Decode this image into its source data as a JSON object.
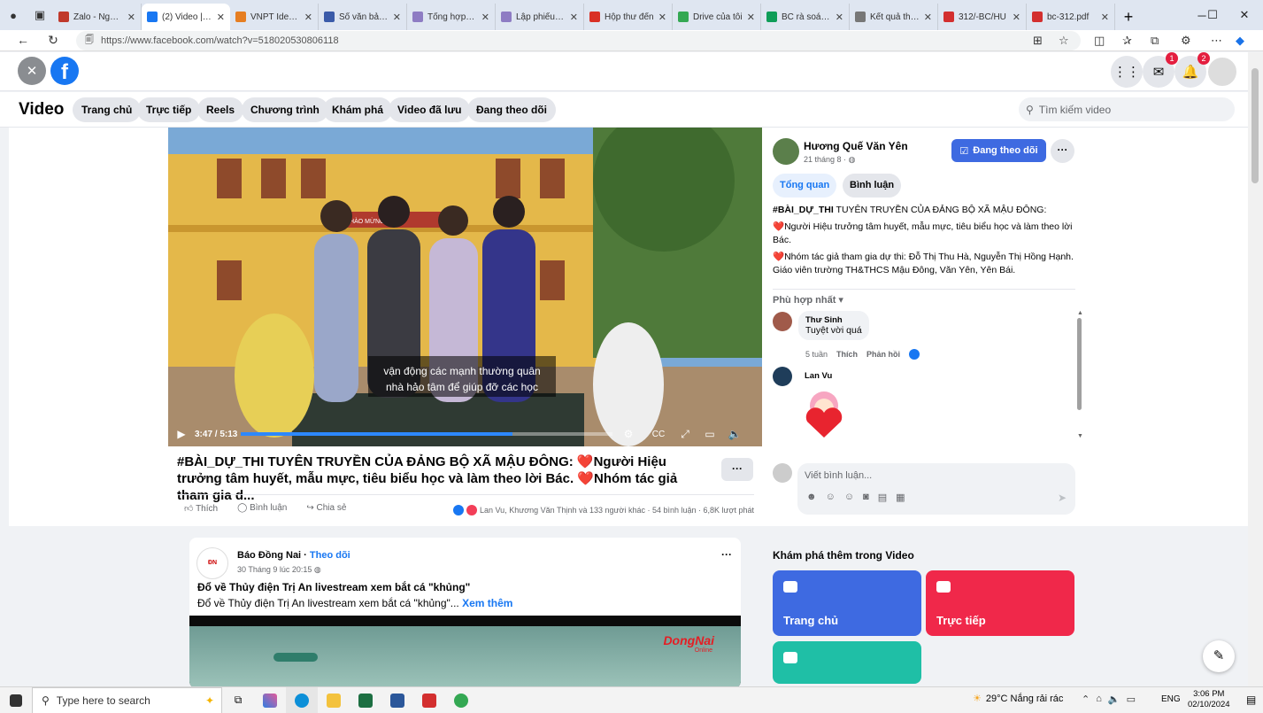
{
  "browser": {
    "tabs": [
      {
        "title": "Zalo - Nguyễ",
        "color": "#c0392b"
      },
      {
        "title": "(2) Video | Fa",
        "color": "#1877f2",
        "active": true
      },
      {
        "title": "VNPT Identity",
        "color": "#e67e22"
      },
      {
        "title": "Sổ văn bản đi",
        "color": "#3b5ba9"
      },
      {
        "title": "Tổng hợp thu",
        "color": "#8e7cc3"
      },
      {
        "title": "Lập phiếu thu",
        "color": "#8e7cc3"
      },
      {
        "title": "Hộp thư đến",
        "color": "#d93025"
      },
      {
        "title": "Drive của tôi",
        "color": "#34a853"
      },
      {
        "title": "BC rà soát vă",
        "color": "#0f9d58"
      },
      {
        "title": "Kết quả thực",
        "color": "#777777"
      },
      {
        "title": "312/-BC/HU",
        "color": "#d32f2f"
      },
      {
        "title": "bc-312.pdf",
        "color": "#d32f2f"
      }
    ],
    "url": "https://www.facebook.com/watch?v=518020530806118",
    "new_tab": "+"
  },
  "fb": {
    "messenger_badge": "1",
    "notif_badge": "2",
    "section_title": "Video",
    "nav": [
      "Trang chủ",
      "Trực tiếp",
      "Reels",
      "Chương trình",
      "Khám phá",
      "Video đã lưu",
      "Đang theo dõi"
    ],
    "search_placeholder": "Tìm kiếm video"
  },
  "video": {
    "subtitle1": "vận động các mạnh thường quân",
    "subtitle2": "nhà hảo tâm để giúp đỡ các học",
    "time": "3:47 / 5:13",
    "progress": 0.73,
    "banner": "CHÀO MỪNG NGÀY",
    "title": "#BÀI_DỰ_THI TUYÊN TRUYỀN CỦA ĐẢNG BỘ XÃ MẬU ĐÔNG: ❤️Người Hiệu trưởng tâm huyết, mẫu mực, tiêu biểu học và làm theo lời Bác. ❤️Nhóm tác giả tham gia d...",
    "more": "···",
    "actions": {
      "like": "Thích",
      "comment": "Bình luận",
      "share": "Chia sẻ"
    },
    "stats": "Lan Vu, Khương Văn Thịnh và 133 người khác · 54 bình luận · 6,8K lượt phát"
  },
  "side": {
    "page_name": "Hương Quế Văn Yên",
    "date": "21 tháng 8 ·",
    "follow": "Đang theo dõi",
    "tabs": [
      "Tổng quan",
      "Bình luận"
    ],
    "desc_hashtag": "#BÀI_DỰ_THI",
    "desc1": " TUYÊN TRUYỀN CỦA ĐẢNG BỘ XÃ MẬU ĐÔNG:",
    "desc2": "❤️Người Hiệu trưởng tâm huyết, mẫu mực, tiêu biểu học và làm theo lời Bác.",
    "desc3": "❤️Nhóm tác giả tham gia dự thi: Đỗ Thị Thu Hà, Nguyễn Thị Hồng Hạnh. Giáo viên trường TH&THCS Mậu Đông, Văn Yên, Yên Bái.",
    "sort": "Phù hợp nhất",
    "comments": [
      {
        "name": "Thư Sinh",
        "text": "Tuyệt vời quá",
        "time": "5 tuần",
        "like": "Thích",
        "reply": "Phản hồi"
      },
      {
        "name": "Lan Vu",
        "text": ""
      }
    ],
    "write_placeholder": "Viết bình luận...",
    "explore_title": "Khám phá thêm trong Video",
    "tiles": [
      {
        "label": "Trang chủ",
        "color": "#3e6ae1"
      },
      {
        "label": "Trực tiếp",
        "color": "#f0284a"
      },
      {
        "label": "",
        "color": "#1fbfa6"
      }
    ]
  },
  "feed": {
    "page": "Báo Đồng Nai",
    "follow": "Theo dõi",
    "time": "30 Tháng 9 lúc 20:15",
    "title": "Đổ về Thủy điện Trị An livestream xem bắt cá \"khủng\"",
    "text": "Đổ về Thủy điện Trị An livestream xem bắt cá \"khủng\"...",
    "see_more": "Xem thêm",
    "watermark": "DongNai",
    "watermark_sub": "Online"
  },
  "taskbar": {
    "search": "Type here to search",
    "weather": "29°C  Nắng rải rác",
    "lang": "ENG",
    "time": "3:06 PM",
    "date": "02/10/2024"
  }
}
